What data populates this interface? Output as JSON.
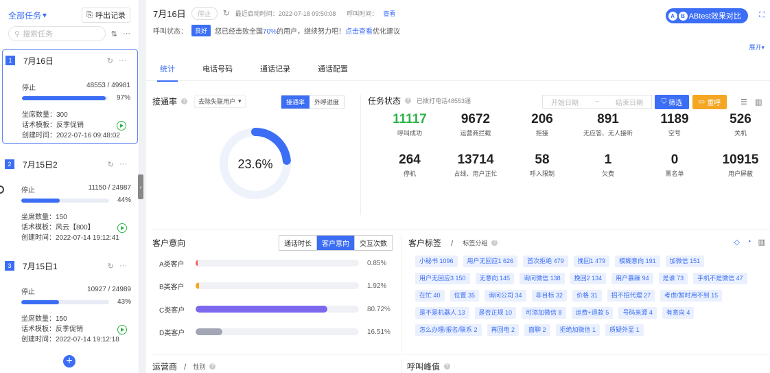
{
  "sidebar": {
    "all_tasks": "全部任务",
    "call_log": "呼出记录",
    "search_placeholder": "搜索任务",
    "tasks": [
      {
        "num": "1",
        "title": "7月16日",
        "status": "停止",
        "progress_text": "48553 / 49981",
        "percent": "97%",
        "progress": 0.97,
        "seats": "坐席数量：300",
        "template": "话术模板：反季促销",
        "created": "创建时间：2022-07-16 09:48:02"
      },
      {
        "num": "2",
        "title": "7月15日2",
        "status": "停止",
        "progress_text": "11150 / 24987",
        "percent": "44%",
        "progress": 0.44,
        "seats": "坐席数量：150",
        "template": "话术模板：风云【800】",
        "created": "创建时间：2022-07-14 19:12:41"
      },
      {
        "num": "3",
        "title": "7月15日1",
        "status": "停止",
        "progress_text": "10927 / 24989",
        "percent": "43%",
        "progress": 0.43,
        "seats": "坐席数量：150",
        "template": "话术模板：反季促销",
        "created": "创建时间：2022-07-14 19:12:18"
      }
    ]
  },
  "header": {
    "date": "7月16日",
    "stop": "停止",
    "last_start": "最近启动时间：2022-07-18 09:50:08",
    "call_time": "呼叫时间：",
    "view": "查看",
    "ab_badge_a": "A",
    "ab_badge_b": "B",
    "ab_label": "ABtest效果对比",
    "call_status_label": "呼叫状态：",
    "good": "良好",
    "status_text_1": "您已经击败全国",
    "status_pct": "70%",
    "status_text_2": "的用户，继续努力吧！",
    "click_view": "点击查看",
    "status_text_3": "优化建议",
    "expand": "展开"
  },
  "tabs": [
    "统计",
    "电话号码",
    "通话记录",
    "通话配置"
  ],
  "connect": {
    "title": "接通率",
    "select": "去除失联用户",
    "seg_on": "接通率",
    "seg_off": "外呼进度",
    "value": "23.6%",
    "ratio": 0.236
  },
  "status": {
    "title": "任务状态",
    "sub": "已拨打电话48553通",
    "start_date": "开始日期",
    "tilde": "~",
    "end_date": "结束日期",
    "filter": "筛选",
    "reset": "重呼",
    "stats": [
      {
        "v": "11117",
        "l": "呼叫成功"
      },
      {
        "v": "9672",
        "l": "运营商拦截"
      },
      {
        "v": "206",
        "l": "拒接"
      },
      {
        "v": "891",
        "l": "无应答、无人接听"
      },
      {
        "v": "1189",
        "l": "空号"
      },
      {
        "v": "526",
        "l": "关机"
      },
      {
        "v": "264",
        "l": "停机"
      },
      {
        "v": "13714",
        "l": "占线、用户正忙"
      },
      {
        "v": "58",
        "l": "呼入限制"
      },
      {
        "v": "1",
        "l": "欠费"
      },
      {
        "v": "0",
        "l": "黑名单"
      },
      {
        "v": "10915",
        "l": "用户屏蔽"
      }
    ]
  },
  "intent": {
    "title": "客户意向",
    "seg": [
      "通话时长",
      "客户意向",
      "交互次数"
    ],
    "rows": [
      {
        "label": "A类客户",
        "pct": "0.85%",
        "value": 0.85,
        "color": "#f25c54"
      },
      {
        "label": "B类客户",
        "pct": "1.92%",
        "value": 1.92,
        "color": "#f5a623"
      },
      {
        "label": "C类客户",
        "pct": "80.72%",
        "value": 80.72,
        "color": "#7b68ee"
      },
      {
        "label": "D类客户",
        "pct": "16.51%",
        "value": 16.51,
        "color": "#a3a6b4"
      }
    ]
  },
  "tags": {
    "title": "客户标签",
    "sep": "/",
    "sub": "标签分组",
    "items": [
      "小秘书 1096",
      "用户无回应1 626",
      "首次拒绝 479",
      "挽回1 479",
      "模糊意向 191",
      "加微信 151",
      "用户无回应3 150",
      "无意向 145",
      "询问微信 138",
      "挽回2 134",
      "用户暴躁 94",
      "是谁 73",
      "手机不是微信 47",
      "在忙 40",
      "位置 35",
      "询问公司 34",
      "非目标 32",
      "价格 31",
      "招不招代理 27",
      "考虑/暂时用不到 15",
      "是不是机器人 13",
      "是否正规 10",
      "可添加微信 8",
      "运费+退款 5",
      "号码来源 4",
      "有意向 4",
      "怎么办理/报名/联系 2",
      "再回电 2",
      "面聊 2",
      "拒绝加微信 1",
      "质疑外显 1"
    ]
  },
  "bottom": {
    "carrier": "运营商",
    "sep": "/",
    "gender": "性别",
    "peak": "呼叫峰值"
  },
  "colors": {
    "accent": "#3b6ef5",
    "success": "#2db34a",
    "warning": "#f5a623"
  }
}
